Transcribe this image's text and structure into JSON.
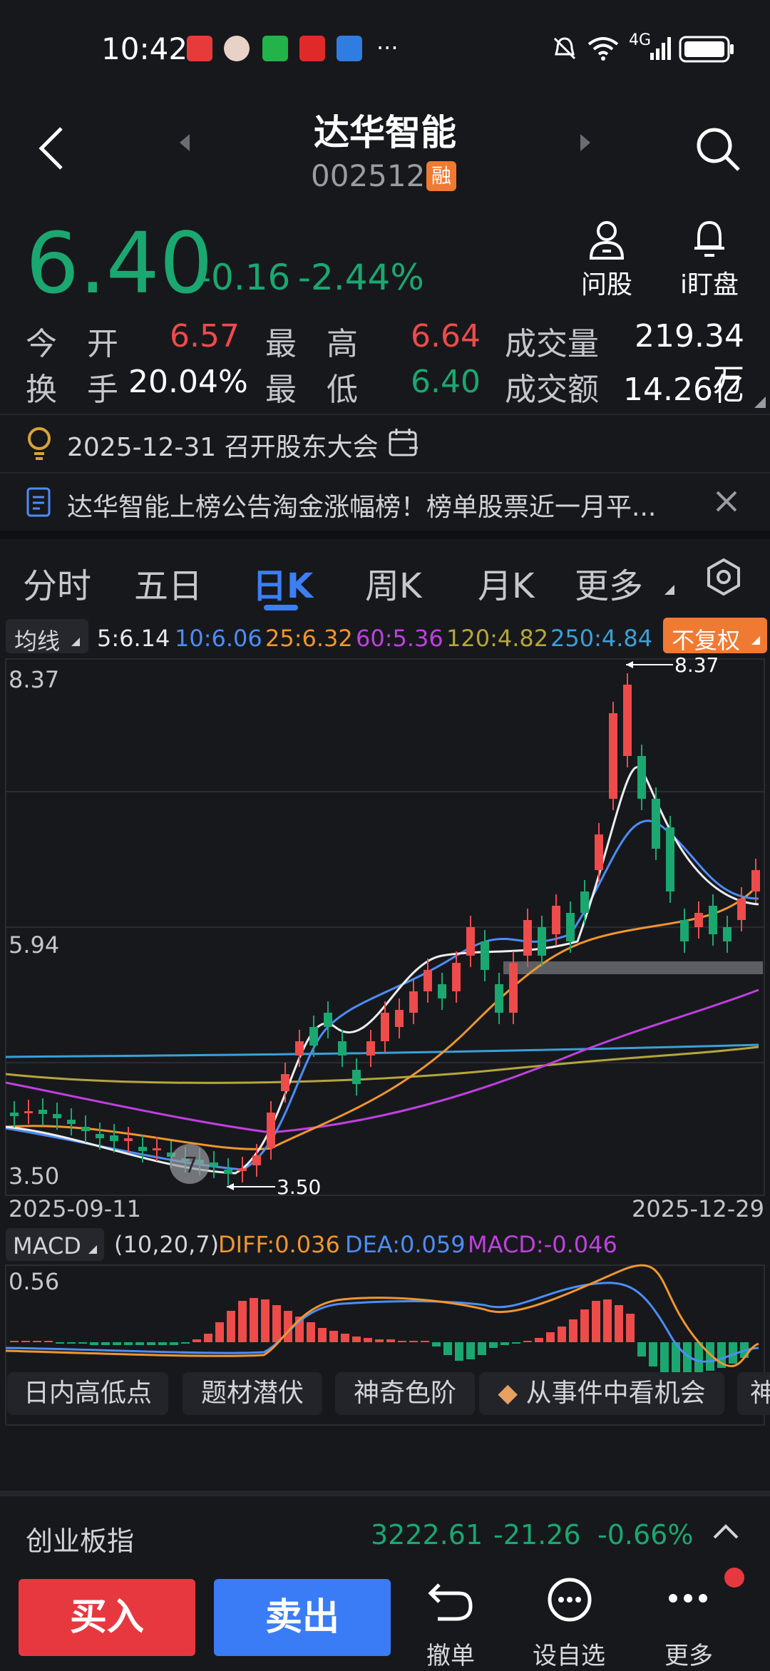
{
  "status_bar": {
    "time": "10:42",
    "more": "···",
    "network": "4G"
  },
  "header": {
    "title": "达华智能",
    "code": "002512",
    "margin_badge": "融"
  },
  "quote": {
    "price": "6.40",
    "change": "-0.16",
    "change_pct": "-2.44%",
    "actions": [
      {
        "label": "问股",
        "icon": "person-icon"
      },
      {
        "label": "i盯盘",
        "icon": "bell-icon"
      }
    ]
  },
  "stats": {
    "open_label": "今 开",
    "open": "6.57",
    "high_label": "最 高",
    "high": "6.64",
    "volume_label": "成交量",
    "volume": "219.34万",
    "turnover_label": "换 手",
    "turnover": "20.04%",
    "low_label": "最 低",
    "low": "6.40",
    "amount_label": "成交额",
    "amount": "14.26亿"
  },
  "notices": [
    {
      "icon": "lightbulb-icon",
      "text": "2025-12-31 召开股东大会"
    },
    {
      "icon": "document-icon",
      "text": "达华智能上榜公告淘金涨幅榜！榜单股票近一月平..."
    }
  ],
  "tabs": [
    "分时",
    "五日",
    "日K",
    "周K",
    "月K",
    "更多"
  ],
  "active_tab": "日K",
  "ma_bar": {
    "label": "均线",
    "items": [
      {
        "text": "5:6.14",
        "color": "#e8e8e8"
      },
      {
        "text": "10:6.06",
        "color": "#4c8df6"
      },
      {
        "text": "25:6.32",
        "color": "#f0962e"
      },
      {
        "text": "60:5.36",
        "color": "#c040e0"
      },
      {
        "text": "120:4.82",
        "color": "#b5a63a"
      },
      {
        "text": "250:4.84",
        "color": "#3aa0d8"
      }
    ],
    "adjust": "不复权"
  },
  "kline": {
    "y_top": "8.37",
    "y_mid": "5.94",
    "y_bottom": "3.50",
    "x_start": "2025-09-11",
    "x_end": "2025-12-29",
    "max_marker": "8.37",
    "min_marker": "3.50"
  },
  "macd": {
    "label": "MACD",
    "params": "(10,20,7)",
    "diff": "DIFF:0.036",
    "dea": "DEA:0.059",
    "macd": "MACD:-0.046",
    "y_top": "0.56"
  },
  "chips": [
    "日内高低点",
    "题材潜伏",
    "神奇色阶",
    "从事件中看机会",
    "神"
  ],
  "index_bar": {
    "name": "创业板指",
    "value": "3222.61",
    "change": "-21.26",
    "pct": "-0.66%"
  },
  "bottom": {
    "buy": "买入",
    "sell": "卖出",
    "actions": [
      {
        "label": "撤单"
      },
      {
        "label": "设自选"
      },
      {
        "label": "更多"
      }
    ]
  },
  "colors": {
    "up": "#ee4b4b",
    "down": "#1aa870",
    "accent": "#2a6ff0",
    "buy": "#e8383f",
    "sell": "#3a7cf6"
  }
}
